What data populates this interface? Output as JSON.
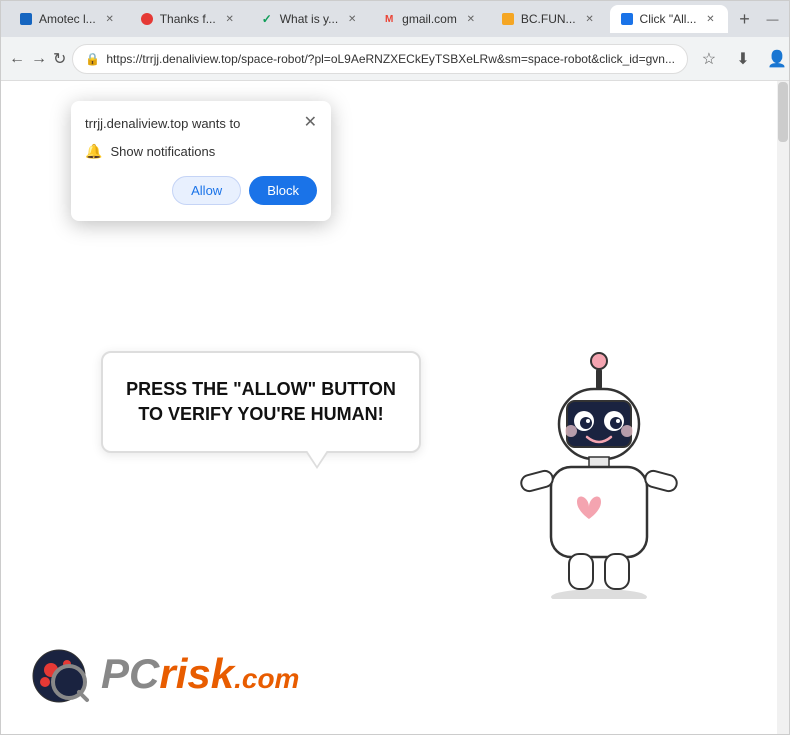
{
  "browser": {
    "title_bar": {
      "tabs": [
        {
          "id": "tab-amotec",
          "label": "Amotec l...",
          "favicon": "blue",
          "active": false
        },
        {
          "id": "tab-thanks",
          "label": "Thanks f...",
          "favicon": "red",
          "active": false
        },
        {
          "id": "tab-whatis",
          "label": "What is y...",
          "favicon": "check",
          "active": false
        },
        {
          "id": "tab-gmail",
          "label": "gmail.com",
          "favicon": "gmail",
          "active": false
        },
        {
          "id": "tab-bcfun",
          "label": "BC.FUN...",
          "favicon": "bc",
          "active": false
        },
        {
          "id": "tab-click",
          "label": "Click \"All...",
          "favicon": "blue",
          "active": true
        }
      ],
      "new_tab_label": "+",
      "controls": {
        "minimize": "—",
        "maximize": "□",
        "close": "✕"
      }
    },
    "nav_bar": {
      "back_label": "←",
      "forward_label": "→",
      "refresh_label": "↻",
      "address": "https://trrjj.denaliview.top/space-robot/?pl=oL9AeRNZXECkEyTSBXeLRw&sm=space-robot&click_id=gvn...",
      "bookmark_label": "☆",
      "download_label": "⬇",
      "profile_label": "👤",
      "menu_label": "⋮"
    }
  },
  "notification_popup": {
    "title": "trrjj.denaliview.top wants to",
    "close_label": "✕",
    "notification_label": "Show notifications",
    "allow_label": "Allow",
    "block_label": "Block"
  },
  "page": {
    "speech_bubble": {
      "text": "PRESS THE \"ALLOW\" BUTTON TO VERIFY YOU'RE HUMAN!"
    },
    "brand": {
      "pc_text": "PC",
      "risk_text": "risk",
      "dotcom": ".com"
    }
  }
}
